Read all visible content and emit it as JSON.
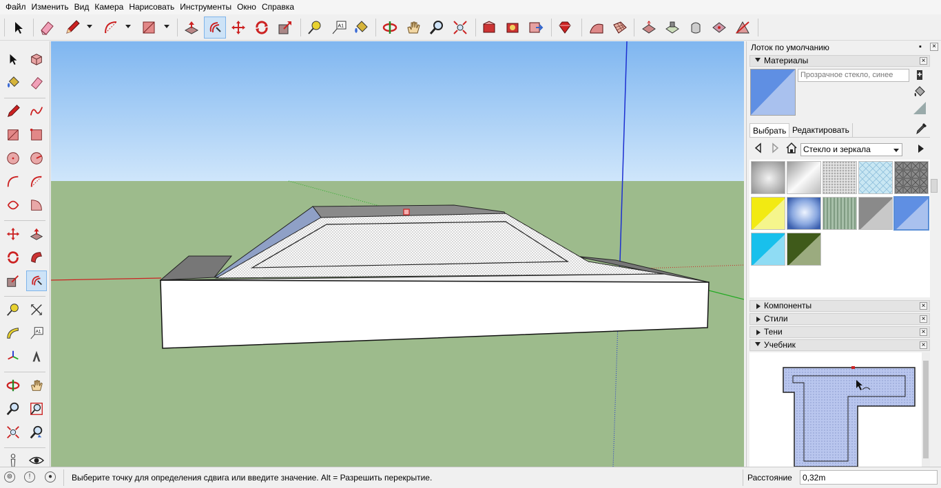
{
  "menu": [
    "Файл",
    "Изменить",
    "Вид",
    "Камера",
    "Нарисовать",
    "Инструменты",
    "Окно",
    "Справка"
  ],
  "tray": {
    "title": "Лоток по умолчанию",
    "materials": {
      "header": "Материалы",
      "name_value": "Прозрачное стекло, синее",
      "tab_select": "Выбрать",
      "tab_edit": "Редактировать",
      "collection": "Стекло и зеркала"
    },
    "sections": {
      "components": "Компоненты",
      "styles": "Стили",
      "shadows": "Тени",
      "tutorial": "Учебник"
    }
  },
  "status": {
    "message": "Выберите точку для определения сдвига или введите значение. Alt = Разрешить перекрытие.",
    "measure_label": "Расстояние",
    "measure_value": "0,32m"
  },
  "colors": {
    "sky_top": "#7fb6f0",
    "sky_bottom": "#cfe6fb",
    "ground": "#9dbb8c",
    "selected_material": "#5f8fe3",
    "axis_blue": "#1c2fd1",
    "axis_red": "#cc2222",
    "axis_green": "#22aa22"
  }
}
